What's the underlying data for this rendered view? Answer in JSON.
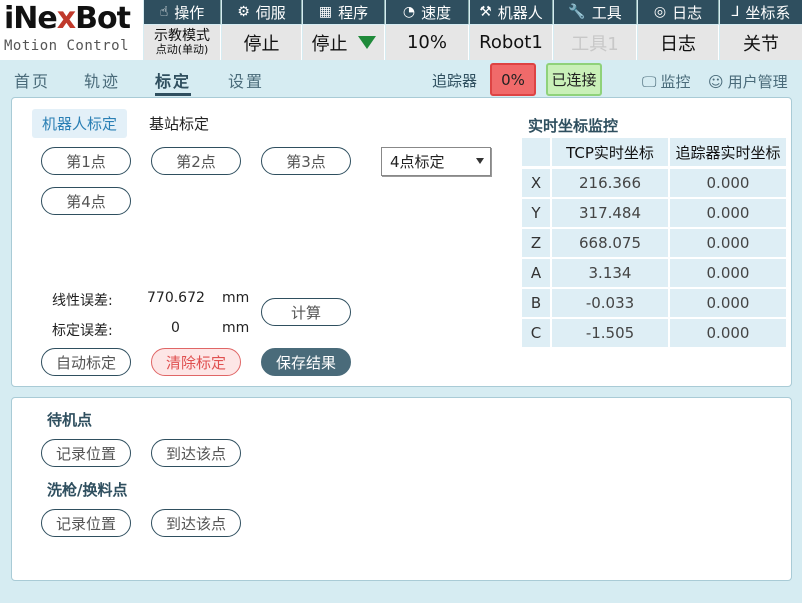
{
  "logo": {
    "brand_pre": "iNe",
    "brand_x": "x",
    "brand_post": "Bot",
    "subtitle": "Motion Control"
  },
  "menu": [
    {
      "label": "操作",
      "icon": "hand-icon"
    },
    {
      "label": "伺服",
      "icon": "servo-icon"
    },
    {
      "label": "程序",
      "icon": "grid-icon"
    },
    {
      "label": "速度",
      "icon": "gauge-icon"
    },
    {
      "label": "机器人",
      "icon": "robot-arm-icon"
    },
    {
      "label": "工具",
      "icon": "wrench-icon"
    },
    {
      "label": "日志",
      "icon": "log-icon"
    },
    {
      "label": "坐标系",
      "icon": "axis-icon"
    }
  ],
  "status": {
    "mode_line1": "示教模式",
    "mode_line2": "点动(单动)",
    "servo": "停止",
    "program": "停止",
    "speed": "10%",
    "robot": "Robot1",
    "tool": "工具1",
    "log": "日志",
    "coord": "关节"
  },
  "nav": {
    "home": "首页",
    "track": "轨迹",
    "calib": "标定",
    "settings": "设置"
  },
  "topbar": {
    "tracker_label": "追踪器",
    "tracker_pct": "0%",
    "connection": "已连接",
    "monitor": "监控",
    "user_mgmt": "用户管理"
  },
  "calib": {
    "tabs": [
      "机器人标定",
      "基站标定"
    ],
    "points": [
      "第1点",
      "第2点",
      "第3点",
      "第4点"
    ],
    "mode_select": "4点标定",
    "linear_err_label": "线性误差:",
    "linear_err_value": "770.672",
    "linear_err_unit": "mm",
    "calib_err_label": "标定误差:",
    "calib_err_value": "0",
    "calib_err_unit": "mm",
    "compute": "计算",
    "auto": "自动标定",
    "clear": "清除标定",
    "save": "保存结果"
  },
  "monitor": {
    "title": "实时坐标监控",
    "headers": [
      "TCP实时坐标",
      "追踪器实时坐标"
    ],
    "rows": [
      {
        "axis": "X",
        "tcp": "216.366",
        "tracker": "0.000"
      },
      {
        "axis": "Y",
        "tcp": "317.484",
        "tracker": "0.000"
      },
      {
        "axis": "Z",
        "tcp": "668.075",
        "tracker": "0.000"
      },
      {
        "axis": "A",
        "tcp": "3.134",
        "tracker": "0.000"
      },
      {
        "axis": "B",
        "tcp": "-0.033",
        "tracker": "0.000"
      },
      {
        "axis": "C",
        "tcp": "-1.505",
        "tracker": "0.000"
      }
    ]
  },
  "standby": {
    "title": "待机点",
    "record": "记录位置",
    "goto": "到达该点"
  },
  "clean": {
    "title": "洗枪/换料点",
    "record": "记录位置",
    "goto": "到达该点"
  },
  "colors": {
    "header_bg": "#2f4f5f",
    "accent_blue": "#2a7fb4",
    "alert_red": "#f06a6a",
    "ok_green": "#c9f0b8"
  }
}
